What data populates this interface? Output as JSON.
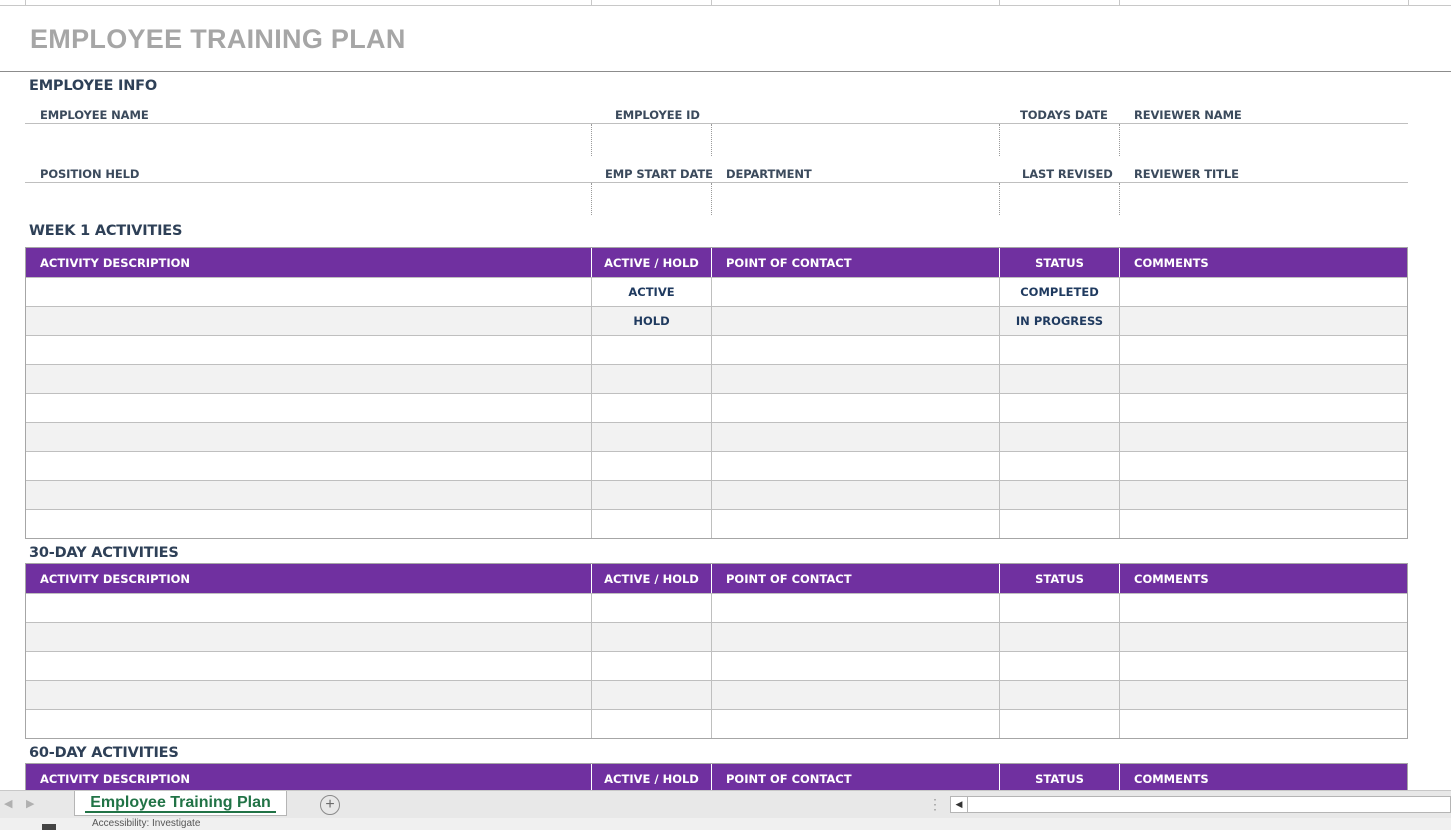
{
  "title": "EMPLOYEE TRAINING PLAN",
  "employee_info": {
    "heading": "EMPLOYEE INFO",
    "labels": {
      "employee_name": "EMPLOYEE NAME",
      "employee_id": "EMPLOYEE ID",
      "todays_date": "TODAYS DATE",
      "reviewer_name": "REVIEWER NAME",
      "position_held": "POSITION HELD",
      "emp_start_date": "EMP START DATE",
      "department": "DEPARTMENT",
      "last_revised": "LAST REVISED",
      "reviewer_title": "REVIEWER TITLE"
    }
  },
  "columns": [
    "ACTIVITY DESCRIPTION",
    "ACTIVE / HOLD",
    "POINT OF CONTACT",
    "STATUS",
    "COMMENTS"
  ],
  "sections": {
    "week1": {
      "heading": "WEEK 1 ACTIVITIES",
      "rows": [
        [
          "",
          "ACTIVE",
          "",
          "COMPLETED",
          ""
        ],
        [
          "",
          "HOLD",
          "",
          "IN PROGRESS",
          ""
        ],
        [
          "",
          "",
          "",
          "",
          ""
        ],
        [
          "",
          "",
          "",
          "",
          ""
        ],
        [
          "",
          "",
          "",
          "",
          ""
        ],
        [
          "",
          "",
          "",
          "",
          ""
        ],
        [
          "",
          "",
          "",
          "",
          ""
        ],
        [
          "",
          "",
          "",
          "",
          ""
        ],
        [
          "",
          "",
          "",
          "",
          ""
        ]
      ]
    },
    "day30": {
      "heading": "30-DAY ACTIVITIES",
      "rows": [
        [
          "",
          "",
          "",
          "",
          ""
        ],
        [
          "",
          "",
          "",
          "",
          ""
        ],
        [
          "",
          "",
          "",
          "",
          ""
        ],
        [
          "",
          "",
          "",
          "",
          ""
        ],
        [
          "",
          "",
          "",
          "",
          ""
        ]
      ]
    },
    "day60": {
      "heading": "60-DAY ACTIVITIES",
      "rows": []
    }
  },
  "tabs": {
    "sheet_name": "Employee Training Plan",
    "add_sheet_icon": "plus-circle-icon"
  },
  "status_bar": {
    "text": "Accessibility: Investigate"
  },
  "colors": {
    "header_purple": "#7030a0",
    "title_gray": "#a6a6a6",
    "tab_green": "#217346"
  }
}
